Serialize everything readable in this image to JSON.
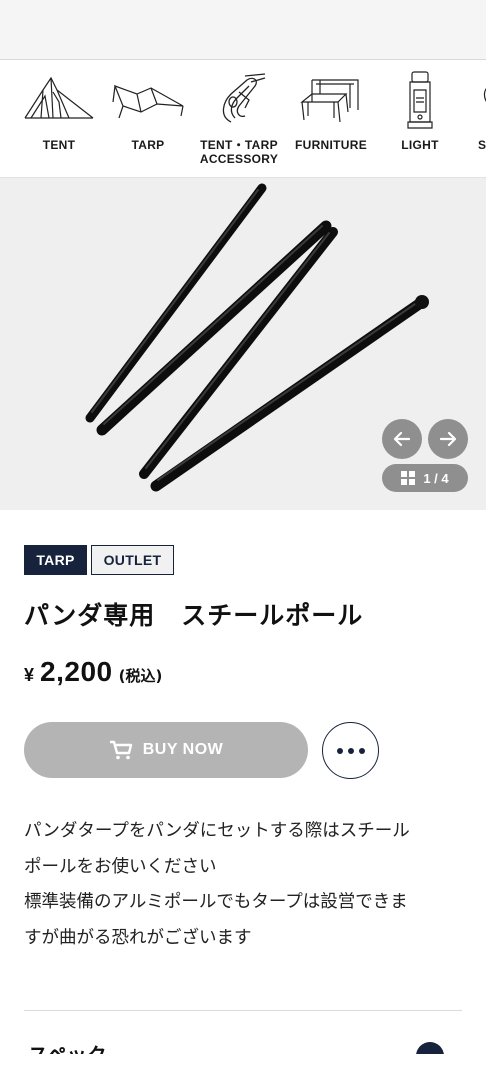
{
  "categories": [
    {
      "label": "TENT",
      "icon": "tent-icon"
    },
    {
      "label": "TARP",
      "icon": "tarp-icon"
    },
    {
      "label": "TENT・TARP\nACCESSORY",
      "icon": "carabiner-icon"
    },
    {
      "label": "FURNITURE",
      "icon": "table-icon"
    },
    {
      "label": "LIGHT",
      "icon": "lantern-icon"
    },
    {
      "label": "S",
      "icon": "partial-icon"
    }
  ],
  "gallery": {
    "counter": "1 / 4",
    "prev_icon": "arrow-left-icon",
    "next_icon": "arrow-right-icon",
    "grid_icon": "grid-icon"
  },
  "product": {
    "tags": [
      "TARP",
      "OUTLET"
    ],
    "title": "パンダ専用　スチールポール",
    "price_symbol": "¥",
    "price": "2,200",
    "tax_note": "(税込)",
    "buy_label": "BUY NOW",
    "description_lines": [
      "パンダタープをパンダにセットする際はスチール",
      "ポールをお使いください",
      "標準装備のアルミポールでもタープは設営できま",
      "すが曲がる恐れがございます"
    ],
    "next_section_heading": "スペック"
  },
  "colors": {
    "navy": "#17233c",
    "buy_disabled": "#b4b4b4",
    "gallery_bg": "#efefef",
    "gallery_control": "#8f8f8f"
  }
}
